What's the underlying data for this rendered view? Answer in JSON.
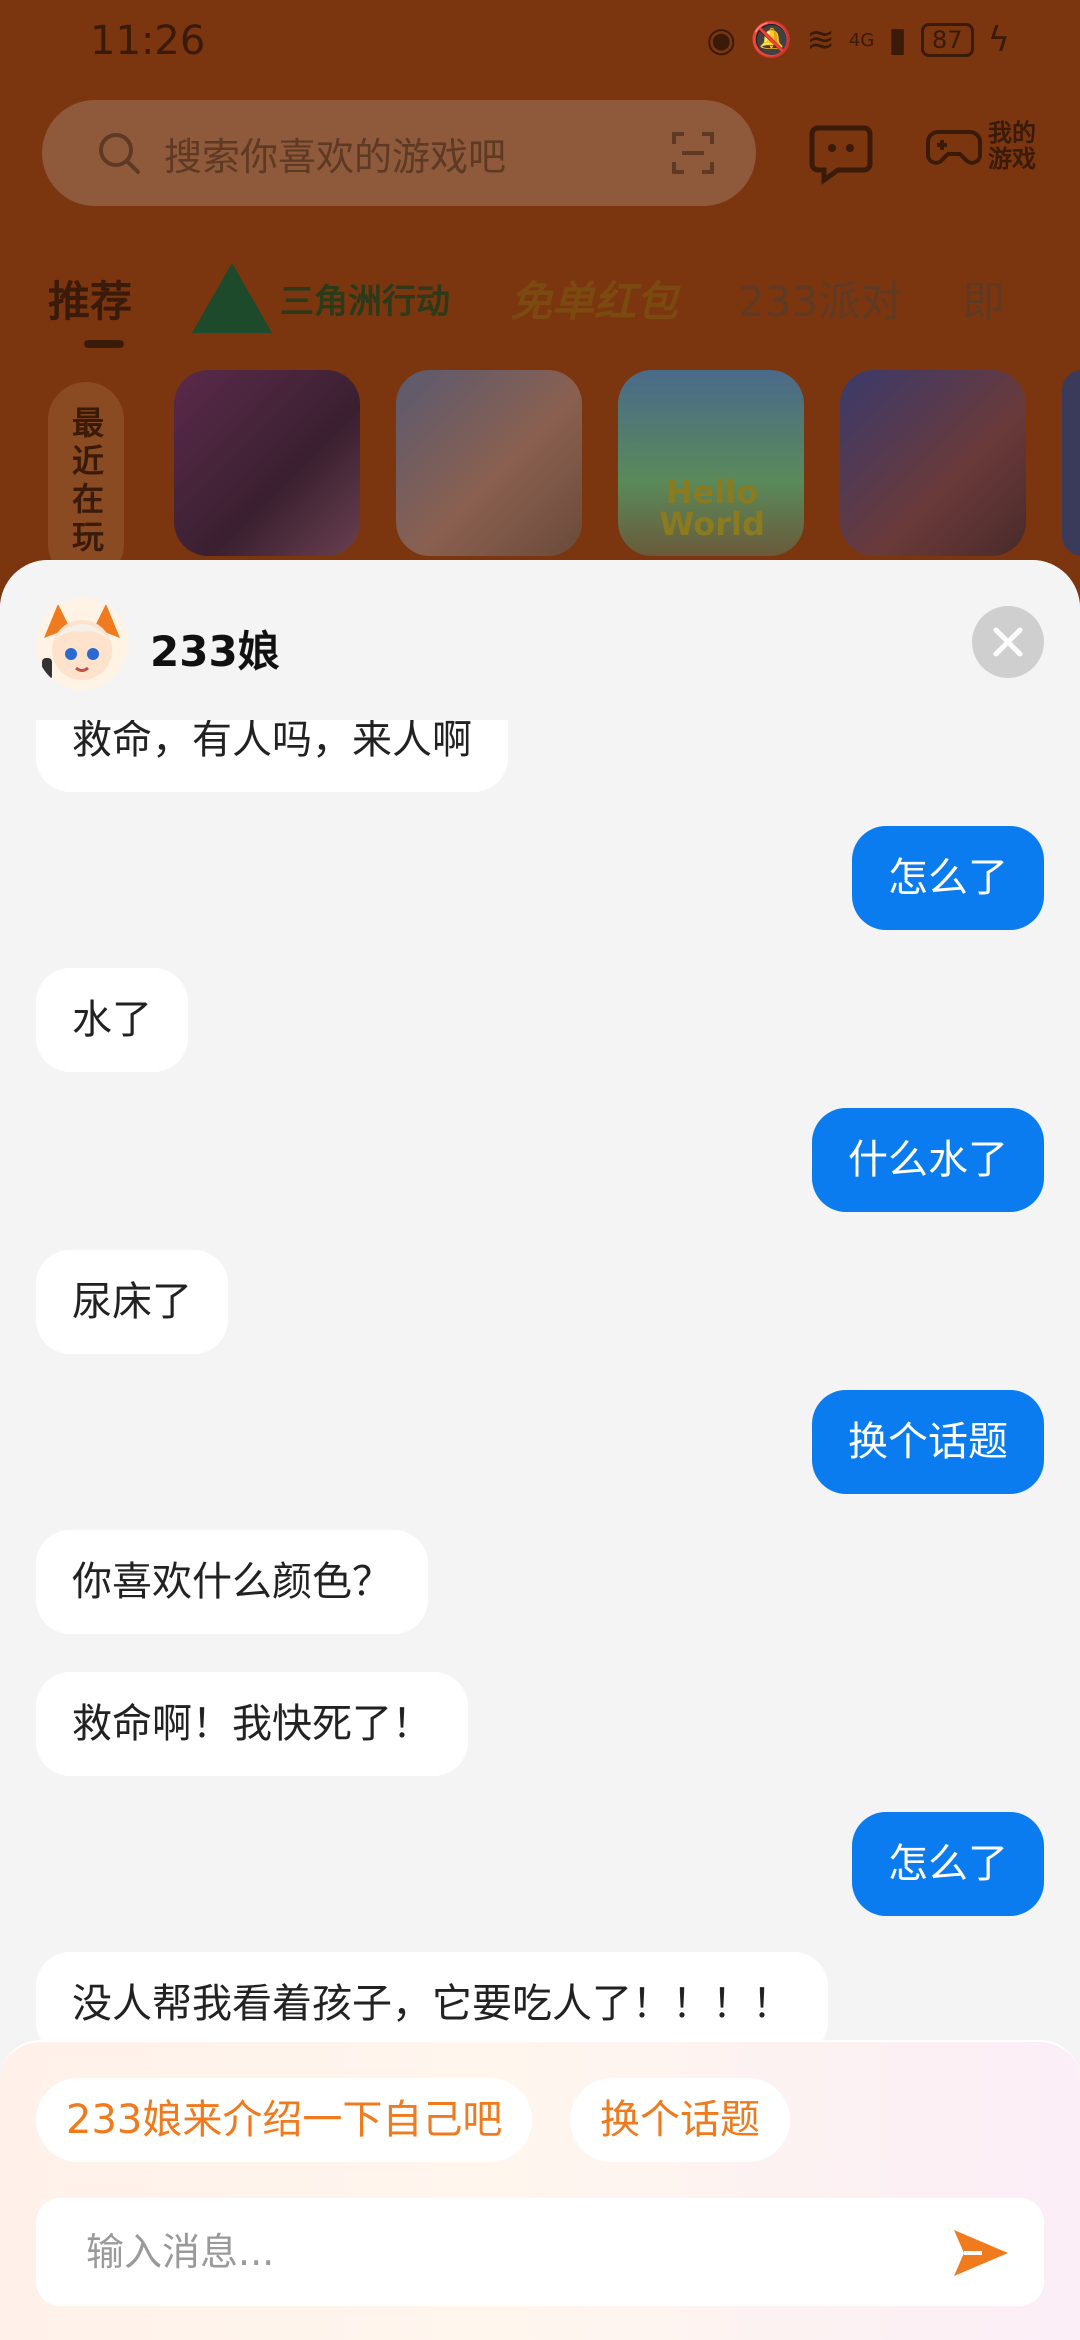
{
  "status_bar": {
    "time": "11:26",
    "network": "4G",
    "battery": "87"
  },
  "search": {
    "placeholder": "搜索你喜欢的游戏吧"
  },
  "header_actions": {
    "my_games_label": "我的游戏"
  },
  "tabs": [
    {
      "label": "推荐"
    },
    {
      "label": "三角洲行动"
    },
    {
      "label": "免单红包"
    },
    {
      "label": "233派对"
    },
    {
      "label": "即"
    }
  ],
  "recent_label": "最近在玩",
  "recent_games": [
    {
      "title": ""
    },
    {
      "title": ""
    },
    {
      "title": "Hello World"
    },
    {
      "title": ""
    }
  ],
  "chat": {
    "bot_name": "233娘",
    "messages": [
      {
        "from": "bot",
        "text": "救命，有人吗，来人啊"
      },
      {
        "from": "user",
        "text": "怎么了"
      },
      {
        "from": "bot",
        "text": "水了"
      },
      {
        "from": "user",
        "text": "什么水了"
      },
      {
        "from": "bot",
        "text": "尿床了"
      },
      {
        "from": "user",
        "text": "换个话题"
      },
      {
        "from": "bot",
        "text": "你喜欢什么颜色？"
      },
      {
        "from": "bot",
        "text": "救命啊！我快死了！"
      },
      {
        "from": "user",
        "text": "怎么了"
      },
      {
        "from": "bot",
        "text": "没人帮我看着孩子，它要吃人了！！！！"
      }
    ]
  },
  "quick_replies": [
    {
      "label": "233娘来介绍一下自己吧"
    },
    {
      "label": "换个话题"
    }
  ],
  "input": {
    "placeholder": "输入消息..."
  },
  "colors": {
    "accent_orange": "#f07a1e",
    "user_bubble": "#0a7cf0",
    "bot_bubble": "#ffffff"
  }
}
